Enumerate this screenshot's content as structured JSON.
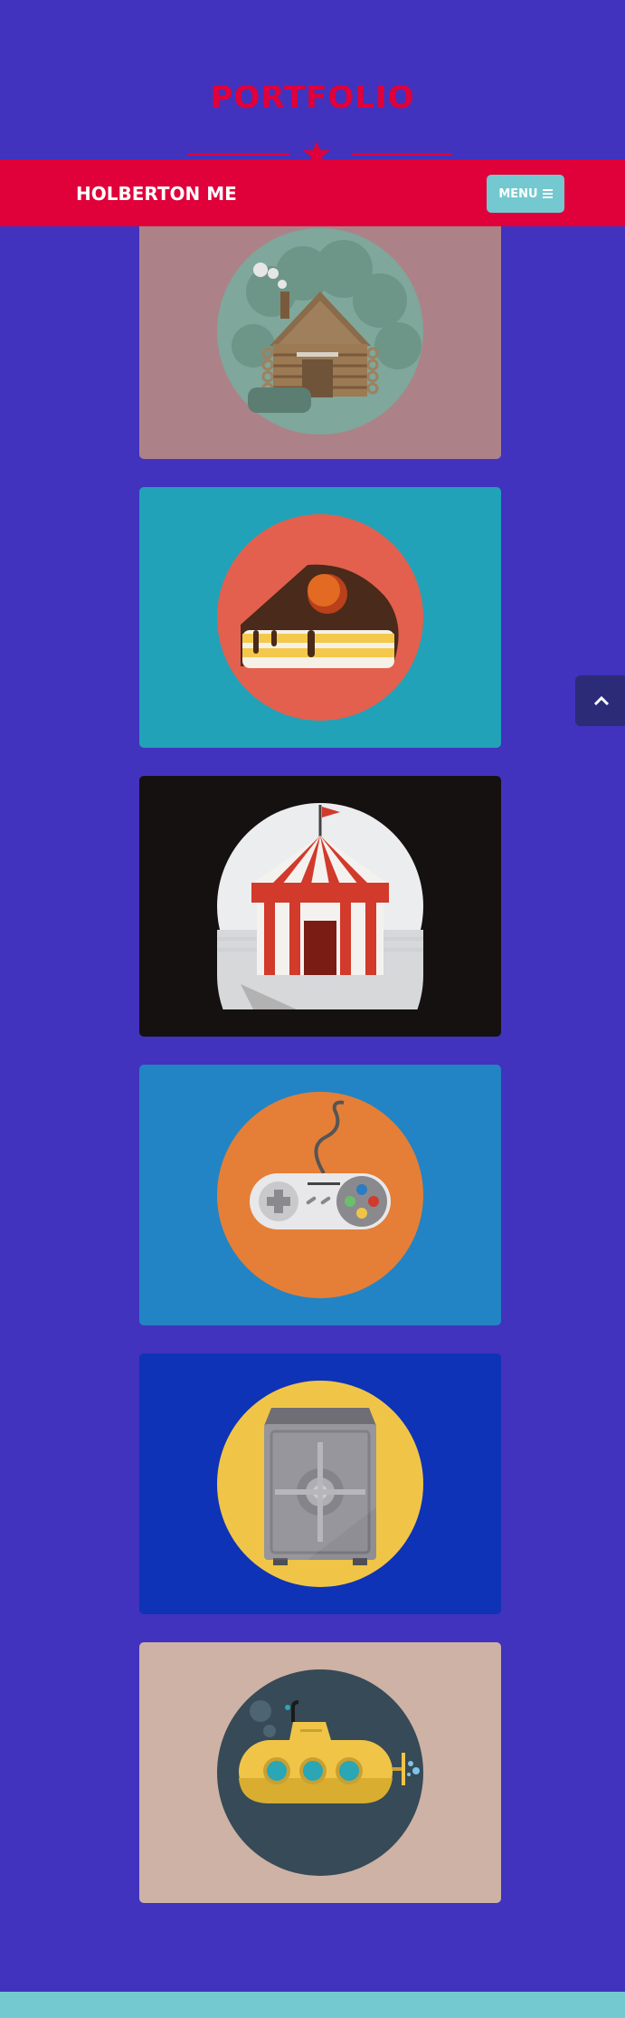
{
  "page": {
    "title": "PORTFOLIO"
  },
  "navbar": {
    "brand": "HOLBERTON ME",
    "menu_label": "MENU"
  },
  "portfolio": {
    "items": [
      {
        "icon": "cabin-icon",
        "background": "#ac8288",
        "circle": "#7fa79b"
      },
      {
        "icon": "cake-icon",
        "background": "#21a2b8",
        "circle": "#e3604e"
      },
      {
        "icon": "circus-tent-icon",
        "background": "#151111",
        "circle": "#ecedee"
      },
      {
        "icon": "game-controller-icon",
        "background": "#2284c4",
        "circle": "#e57f37"
      },
      {
        "icon": "safe-icon",
        "background": "#0f33b6",
        "circle": "#f0c547"
      },
      {
        "icon": "submarine-icon",
        "background": "#cdb2a5",
        "circle": "#364a57"
      }
    ]
  },
  "colors": {
    "page_background": "#4133bd",
    "accent": "#e0003a",
    "menu_button": "#73c9cf",
    "scroll_top_button": "#2c2b78"
  },
  "scroll_top": {
    "icon": "chevron-up-icon"
  }
}
